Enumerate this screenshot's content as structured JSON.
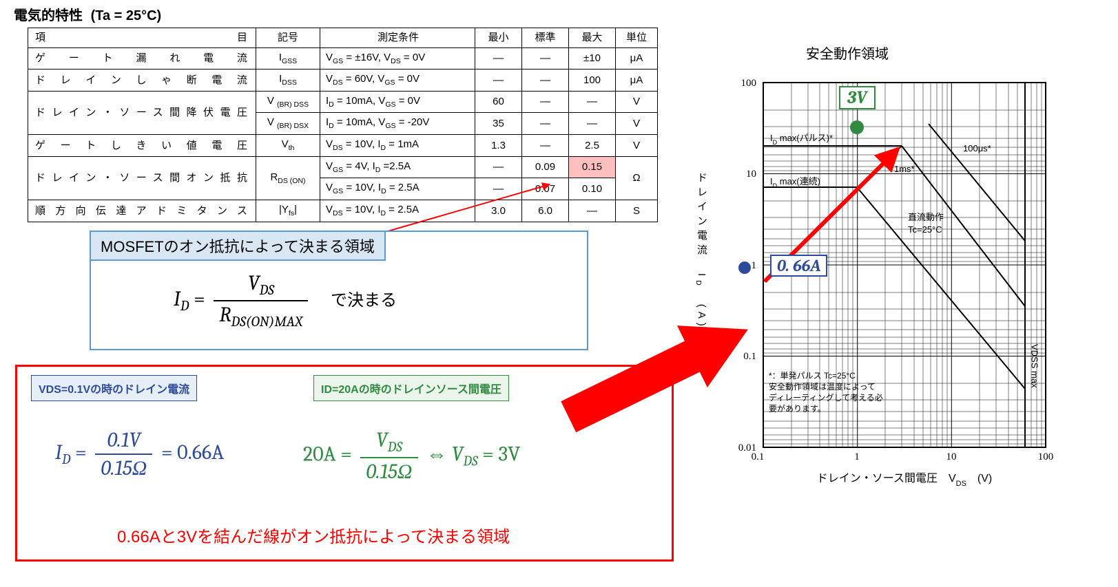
{
  "page": {
    "heading": "電気的特性",
    "condition": "(Ta = 25°C)"
  },
  "table": {
    "headers": {
      "param": "項目",
      "symbol": "記号",
      "cond": "測定条件",
      "min": "最小",
      "typ": "標準",
      "max": "最大",
      "unit": "単位"
    },
    "rows": [
      {
        "param": "ゲート漏れ電流",
        "symbol": "IGSS",
        "cond": "VGS = ±16V, VDS = 0V",
        "min": "—",
        "typ": "—",
        "max": "±10",
        "unit": "μA"
      },
      {
        "param": "ドレインしゃ断電流",
        "symbol": "IDSS",
        "cond": "VDS = 60V, VGS = 0V",
        "min": "—",
        "typ": "—",
        "max": "100",
        "unit": "μA"
      },
      {
        "param": "ドレイン・ソース間降伏電圧",
        "symbol": "V (BR) DSS",
        "cond": "ID = 10mA, VGS = 0V",
        "min": "60",
        "typ": "—",
        "max": "—",
        "unit": "V"
      },
      {
        "param": "",
        "symbol": "V (BR) DSX",
        "cond": "ID = 10mA, VGS = -20V",
        "min": "35",
        "typ": "—",
        "max": "—",
        "unit": "V"
      },
      {
        "param": "ゲートしきい値電圧",
        "symbol": "Vth",
        "cond": "VDS = 10V, ID = 1mA",
        "min": "1.3",
        "typ": "—",
        "max": "2.5",
        "unit": "V"
      },
      {
        "param": "ドレイン・ソース間オン抵抗",
        "symbol": "RDS (ON)",
        "cond": "VGS = 4V, ID =2.5A",
        "min": "—",
        "typ": "0.09",
        "max": "0.15",
        "unit": "Ω"
      },
      {
        "param": "",
        "symbol": "",
        "cond": "VGS = 10V, ID = 2.5A",
        "min": "—",
        "typ": "0.07",
        "max": "0.10",
        "unit": ""
      },
      {
        "param": "順方向伝達アドミタンス",
        "symbol": "|Yfs|",
        "cond": "VDS = 10V, ID = 2.5A",
        "min": "3.0",
        "typ": "6.0",
        "max": "—",
        "unit": "S"
      }
    ]
  },
  "eqbox1": {
    "header": "MOSFETのオン抵抗によって決まる領域",
    "lhs": "I",
    "lhs_sub": "D",
    "num": "V",
    "num_sub": "DS",
    "den": "R",
    "den_sub": "DS(ON)MAX",
    "tail": "で決まる"
  },
  "tags": {
    "blue": "VDS=0.1Vの時のドレイン電流",
    "green": "ID=20Aの時のドレインソース間電圧"
  },
  "calc1": {
    "pre": "I",
    "pre_sub": "D",
    "num": "0.1V",
    "den": "0.15Ω",
    "eq": "= 0.66A"
  },
  "calc2": {
    "pre": "20A =",
    "num": "V",
    "num_sub": "DS",
    "den": "0.15Ω",
    "tail": "⇔ V",
    "tail_sub": "DS",
    "tail2": " = 3V"
  },
  "conclusion": "0.66Aと3Vを結んだ線がオン抵抗によって決まる領域",
  "chart_data": {
    "type": "line",
    "title": "安全動作領域",
    "xlabel": "ドレイン・ソース間電圧  VDS  (V)",
    "ylabel": "ドレイン電流  ID  (A)",
    "xscale": "log",
    "yscale": "log",
    "xlim": [
      0.1,
      100
    ],
    "ylim": [
      0.01,
      100
    ],
    "x_ticks": [
      "0.1",
      "1",
      "10",
      "100"
    ],
    "y_ticks": [
      "0.01",
      "0.1",
      "1",
      "10",
      "100"
    ],
    "annotations": [
      "ID max(パルス)*",
      "ID max(連続)",
      "1ms*",
      "100μs*",
      "直流動作 Tc=25°C",
      "*：単発パルス Tc=25°C 安全動作領域は温度によってディレーティングして考える必要があります。",
      "VDSS max"
    ],
    "highlight_line": {
      "points": [
        {
          "x": 0.1,
          "y": 0.66,
          "label": "0.66A"
        },
        {
          "x": 3,
          "y": 20,
          "label": "3V"
        }
      ],
      "color": "#ff0000"
    }
  },
  "badges": {
    "v": "3V",
    "a": "0. 66A"
  }
}
